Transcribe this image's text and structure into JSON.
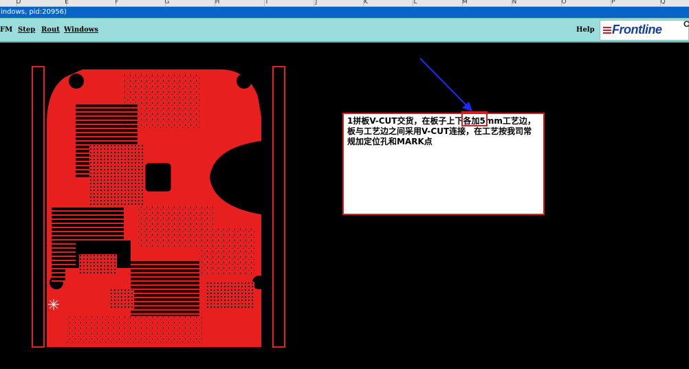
{
  "sheet_columns": [
    "D",
    "E",
    "F",
    "G",
    "H",
    "I",
    "J",
    "K",
    "L",
    "M",
    "N",
    "O",
    "P",
    "Q"
  ],
  "window_title": "indows, pid:20956)",
  "menu": {
    "items": [
      {
        "label": "FM"
      },
      {
        "label": "Step"
      },
      {
        "label": "Rout"
      },
      {
        "label": "Windows"
      }
    ],
    "help": "Help"
  },
  "logo": {
    "text": "Frontline",
    "mark": "C"
  },
  "note": {
    "text": "1拼板V-CUT交货，在板子上下各加5mm工艺边，板与工艺边之间采用V-CUT连接，在工艺按我司常规加定位孔和MARK点",
    "highlight": "上下"
  },
  "colors": {
    "board": "#e81f1f",
    "background": "#000000",
    "menubar": "#9bdcdc",
    "arrow": "#1a2cff",
    "outline": "#d71d1d"
  }
}
